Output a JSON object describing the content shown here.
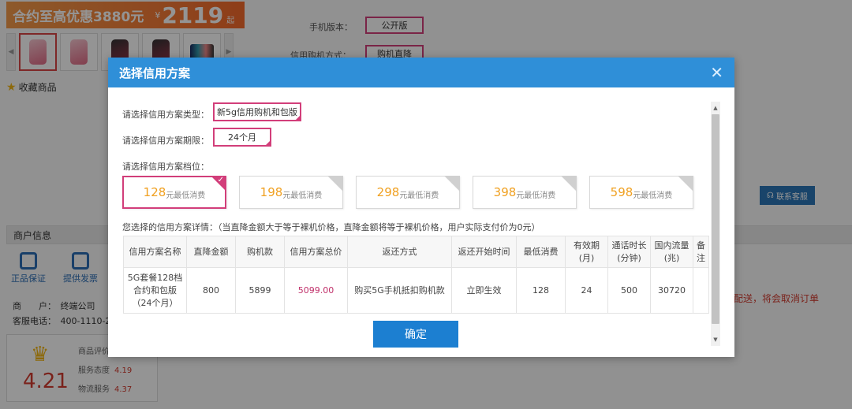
{
  "background": {
    "promo": {
      "text": "合约至高优惠3880元",
      "currency": "¥",
      "price": "2119",
      "suffix": "起"
    },
    "favorite": {
      "label": "收藏商品",
      "icon": "star-icon"
    },
    "specs": [
      {
        "label": "手机版本：",
        "value": "公开版"
      },
      {
        "label": "信用购机方式：",
        "value": "购机直降"
      }
    ],
    "customer_service": {
      "label": "联系客服",
      "icon": "headset-icon"
    },
    "merchant": {
      "title": "商户信息",
      "badges": [
        {
          "label": "正品保证",
          "icon": "shield-icon"
        },
        {
          "label": "提供发票",
          "icon": "invoice-icon"
        }
      ],
      "line1": "商　　户：　终端公司",
      "line2": "客服电话：　400-1110-298",
      "rating_title": "商品评价",
      "score": "4.21",
      "service_label": "服务态度",
      "service_value": "4.19",
      "logistics_label": "物流服务",
      "logistics_value": "4.37"
    },
    "notice": "配送，将会取消订单"
  },
  "modal": {
    "title": "选择信用方案",
    "close_icon": "close-icon",
    "type_label": "请选择信用方案类型：",
    "type_value": "新5g信用购机和包版",
    "term_label": "请选择信用方案期限：",
    "term_value": "24个月",
    "tier_label": "请选择信用方案档位：",
    "tier_suffix": "元最低消费",
    "tiers": [
      {
        "amount": "128",
        "selected": true
      },
      {
        "amount": "198",
        "selected": false
      },
      {
        "amount": "298",
        "selected": false
      },
      {
        "amount": "398",
        "selected": false
      },
      {
        "amount": "598",
        "selected": false
      }
    ],
    "detail_label": "您选择的信用方案详情：（当直降金额大于等于裸机价格，直降金额将等于裸机价格，用户实际支付价为0元）",
    "table": {
      "headers": [
        "信用方案名称",
        "直降金额",
        "购机款",
        "信用方案总价",
        "返还方式",
        "返还开始时间",
        "最低消费",
        "有效期(月)",
        "通话时长(分钟)",
        "国内流量(兆)",
        "备注"
      ],
      "row": [
        "5G套餐128档合约和包版（24个月）",
        "800",
        "5899",
        "5099.00",
        "购买5G手机抵扣购机款",
        "立即生效",
        "128",
        "24",
        "500",
        "30720",
        ""
      ]
    },
    "confirm_label": "确定"
  }
}
